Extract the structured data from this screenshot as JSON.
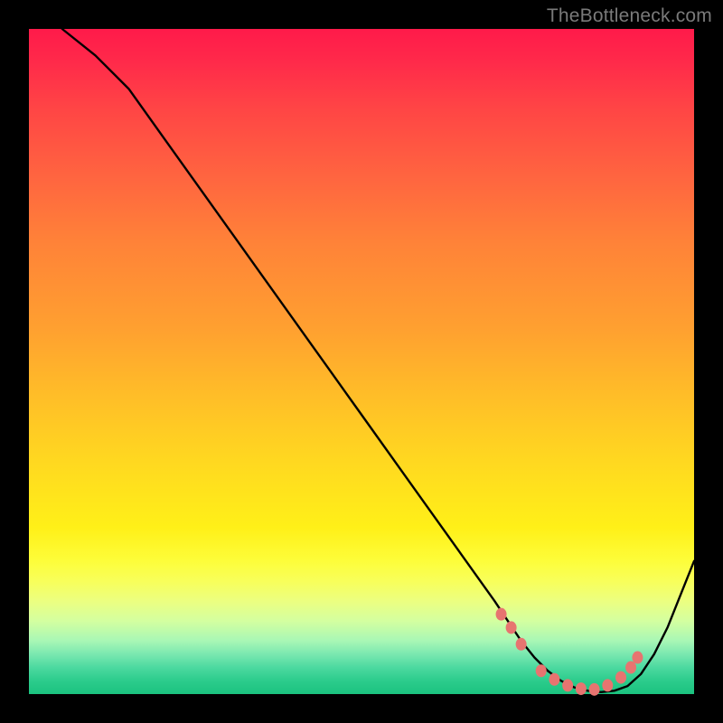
{
  "watermark": "TheBottleneck.com",
  "chart_data": {
    "type": "line",
    "title": "",
    "xlabel": "",
    "ylabel": "",
    "xlim": [
      0,
      100
    ],
    "ylim": [
      0,
      100
    ],
    "grid": false,
    "legend": false,
    "series": [
      {
        "name": "bottleneck-curve",
        "x": [
          5,
          10,
          15,
          20,
          25,
          30,
          35,
          40,
          45,
          50,
          55,
          60,
          65,
          70,
          72,
          74,
          76,
          78,
          80,
          82,
          84,
          86,
          88,
          90,
          92,
          94,
          96,
          98,
          100
        ],
        "values": [
          100,
          96,
          91,
          84,
          77,
          70,
          63,
          56,
          49,
          42,
          35,
          28,
          21,
          14,
          11,
          8,
          5.5,
          3.5,
          2,
          1,
          0.5,
          0.3,
          0.5,
          1.2,
          3,
          6,
          10,
          15,
          20
        ]
      }
    ],
    "markers": {
      "name": "highlight-dots",
      "style": "rounded-rect",
      "color": "#e77470",
      "points": [
        {
          "x": 71,
          "y": 12.0
        },
        {
          "x": 72.5,
          "y": 10.0
        },
        {
          "x": 74,
          "y": 7.5
        },
        {
          "x": 77,
          "y": 3.5
        },
        {
          "x": 79,
          "y": 2.2
        },
        {
          "x": 81,
          "y": 1.3
        },
        {
          "x": 83,
          "y": 0.8
        },
        {
          "x": 85,
          "y": 0.7
        },
        {
          "x": 87,
          "y": 1.3
        },
        {
          "x": 89,
          "y": 2.5
        },
        {
          "x": 90.5,
          "y": 4.0
        },
        {
          "x": 91.5,
          "y": 5.5
        }
      ]
    },
    "background": {
      "type": "vertical-gradient",
      "stops": [
        {
          "pos": 0,
          "color": "#ff1a4a"
        },
        {
          "pos": 50,
          "color": "#ffbd28"
        },
        {
          "pos": 80,
          "color": "#fdfd3a"
        },
        {
          "pos": 100,
          "color": "#1bc27f"
        }
      ]
    }
  }
}
